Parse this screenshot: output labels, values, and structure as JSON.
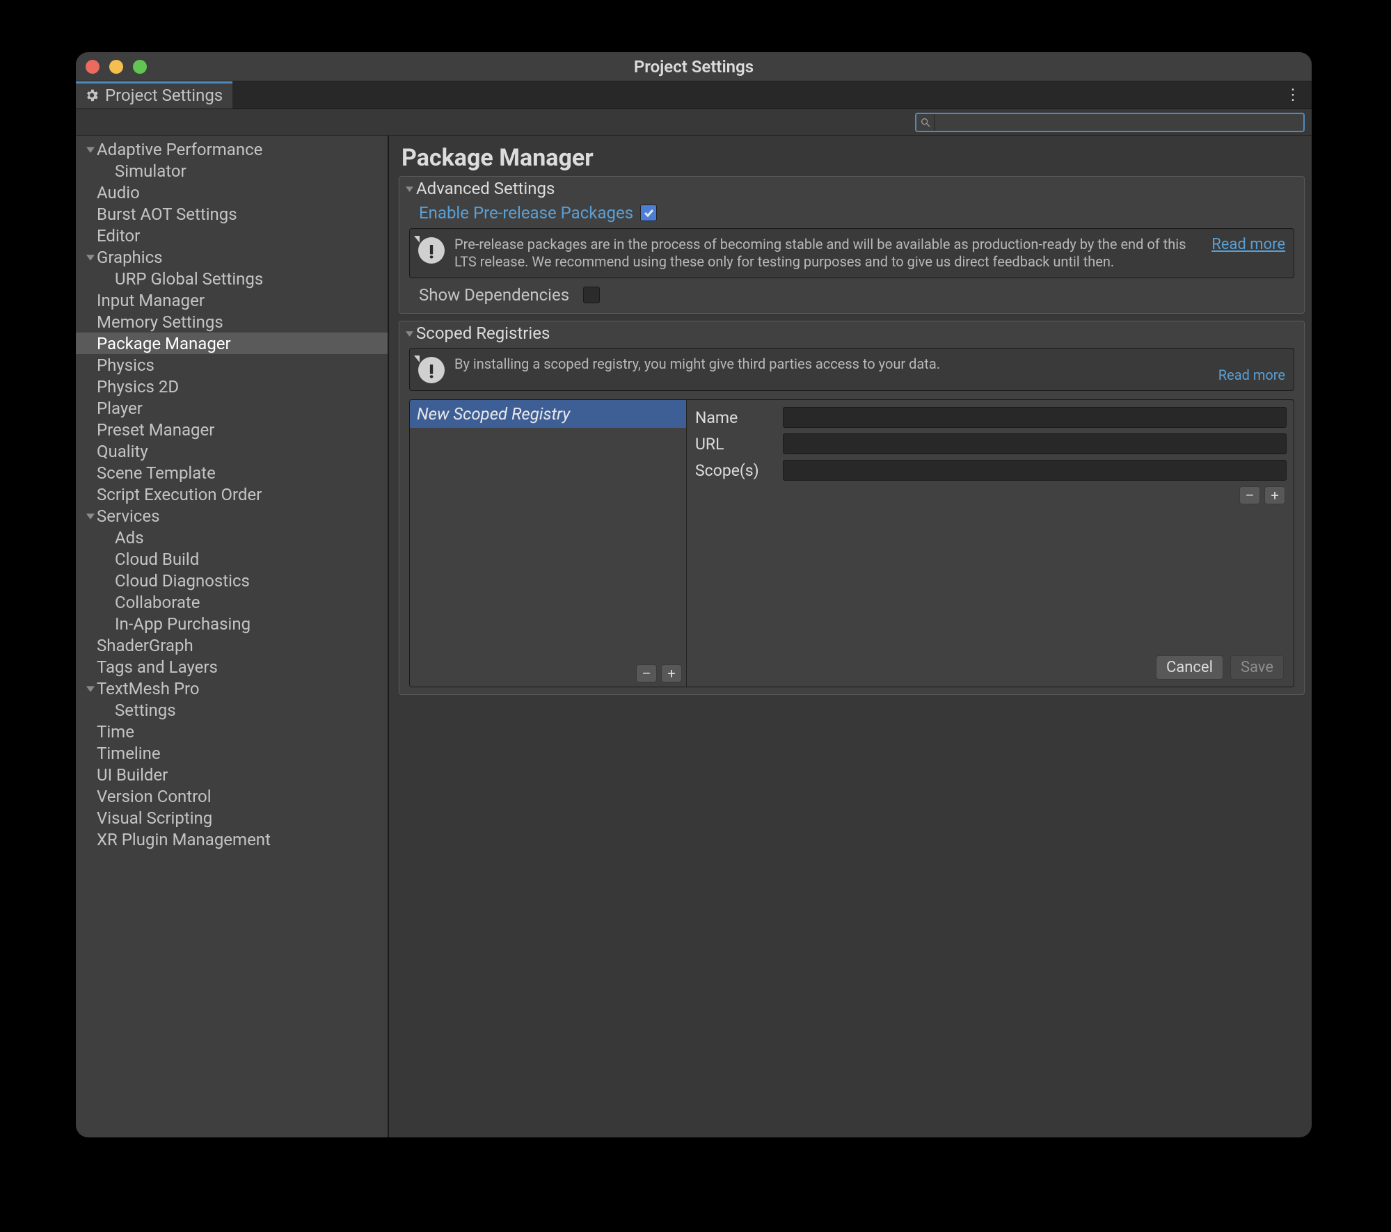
{
  "window": {
    "title": "Project Settings"
  },
  "tab": {
    "label": "Project Settings"
  },
  "kebab": "⋮",
  "search": {
    "placeholder": ""
  },
  "sidebar": [
    {
      "label": "Adaptive Performance",
      "level": 0,
      "fold": true
    },
    {
      "label": "Simulator",
      "level": 1
    },
    {
      "label": "Audio",
      "level": 0
    },
    {
      "label": "Burst AOT Settings",
      "level": 0
    },
    {
      "label": "Editor",
      "level": 0
    },
    {
      "label": "Graphics",
      "level": 0,
      "fold": true
    },
    {
      "label": "URP Global Settings",
      "level": 1
    },
    {
      "label": "Input Manager",
      "level": 0
    },
    {
      "label": "Memory Settings",
      "level": 0
    },
    {
      "label": "Package Manager",
      "level": 0,
      "selected": true
    },
    {
      "label": "Physics",
      "level": 0
    },
    {
      "label": "Physics 2D",
      "level": 0
    },
    {
      "label": "Player",
      "level": 0
    },
    {
      "label": "Preset Manager",
      "level": 0
    },
    {
      "label": "Quality",
      "level": 0
    },
    {
      "label": "Scene Template",
      "level": 0
    },
    {
      "label": "Script Execution Order",
      "level": 0
    },
    {
      "label": "Services",
      "level": 0,
      "fold": true
    },
    {
      "label": "Ads",
      "level": 1
    },
    {
      "label": "Cloud Build",
      "level": 1
    },
    {
      "label": "Cloud Diagnostics",
      "level": 1
    },
    {
      "label": "Collaborate",
      "level": 1
    },
    {
      "label": "In-App Purchasing",
      "level": 1
    },
    {
      "label": "ShaderGraph",
      "level": 0
    },
    {
      "label": "Tags and Layers",
      "level": 0
    },
    {
      "label": "TextMesh Pro",
      "level": 0,
      "fold": true
    },
    {
      "label": "Settings",
      "level": 1
    },
    {
      "label": "Time",
      "level": 0
    },
    {
      "label": "Timeline",
      "level": 0
    },
    {
      "label": "UI Builder",
      "level": 0
    },
    {
      "label": "Version Control",
      "level": 0
    },
    {
      "label": "Visual Scripting",
      "level": 0
    },
    {
      "label": "XR Plugin Management",
      "level": 0
    }
  ],
  "page": {
    "title": "Package Manager"
  },
  "advanced": {
    "title": "Advanced Settings",
    "enable_pre": "Enable Pre-release Packages",
    "enable_pre_checked": true,
    "info": "Pre-release packages are in the process of becoming stable and will be available as production-ready by the end of this LTS release. We recommend using these only for testing purposes and to give us direct feedback until then.",
    "read_more": "Read more",
    "show_deps": "Show Dependencies",
    "show_deps_checked": false
  },
  "scoped": {
    "title": "Scoped Registries",
    "info": "By installing a scoped registry, you might give third parties access to your data.",
    "read_more": "Read more",
    "list": [
      {
        "label": "New Scoped Registry",
        "selected": true
      }
    ],
    "form": {
      "name_label": "Name",
      "url_label": "URL",
      "scopes_label": "Scope(s)",
      "name_value": "",
      "url_value": "",
      "scopes_value": ""
    },
    "btn_minus": "–",
    "btn_plus": "+",
    "cancel": "Cancel",
    "save": "Save"
  }
}
